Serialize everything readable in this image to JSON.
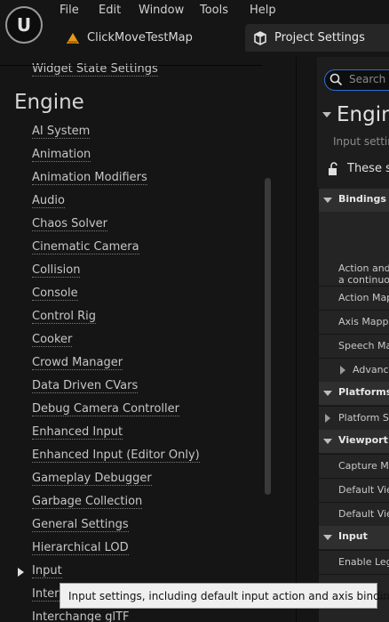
{
  "menu": [
    "File",
    "Edit",
    "Window",
    "Tools",
    "Help"
  ],
  "map_name": "ClickMoveTestMap",
  "tab_label": "Project Settings",
  "left": {
    "partial_top": "Widget State Settings",
    "section_heading": "Engine",
    "items": [
      "AI System",
      "Animation",
      "Animation Modifiers",
      "Audio",
      "Chaos Solver",
      "Cinematic Camera",
      "Collision",
      "Console",
      "Control Rig",
      "Cooker",
      "Crowd Manager",
      "Data Driven CVars",
      "Debug Camera Controller",
      "Enhanced Input",
      "Enhanced Input (Editor Only)",
      "Gameplay Debugger",
      "Garbage Collection",
      "General Settings",
      "Hierarchical LOD",
      "Input",
      "Interc",
      "Interchange glTF"
    ]
  },
  "right": {
    "search_placeholder": "Search",
    "title": "Engin",
    "subtitle": "Input settin",
    "these": "These s",
    "rows": {
      "bindings": "Bindings",
      "action_line1": "Action and ",
      "action_line2": "a continuou",
      "action_map": "Action Map",
      "axis_map": "Axis Mappi",
      "speech_map": "Speech Ma",
      "advanced": "Advance",
      "platforms": "Platforms",
      "platform_se": "Platform Se",
      "viewport": "Viewport Pr",
      "capture": "Capture Mo",
      "default_view1": "Default View",
      "default_view2": "Default View",
      "input": "Input",
      "enable_leg": "Enable Lega"
    }
  },
  "tooltip": "Input settings, including default input action and axis bindings."
}
